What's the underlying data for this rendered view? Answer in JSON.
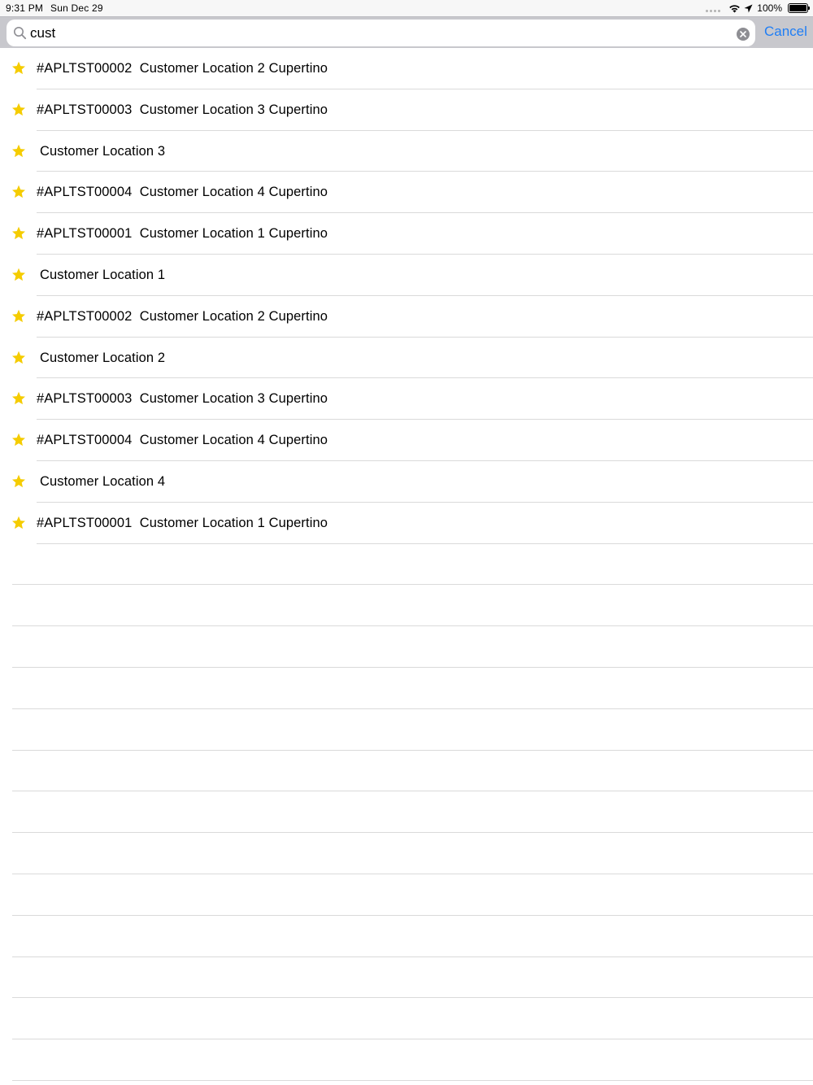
{
  "status_bar": {
    "time": "9:31 PM",
    "date": "Sun Dec 29",
    "battery_percent": "100%",
    "icons": [
      "cellular-dots-icon",
      "wifi-icon",
      "location-arrow-icon",
      "battery-icon"
    ]
  },
  "search": {
    "value": "cust",
    "placeholder": "",
    "cancel_label": "Cancel",
    "accent_color": "#1f7ef5"
  },
  "results": [
    {
      "text": "#APLTST00002  Customer Location 2 Cupertino",
      "starred": true
    },
    {
      "text": "#APLTST00003  Customer Location 3 Cupertino",
      "starred": true
    },
    {
      "text": "Customer Location 3",
      "starred": true
    },
    {
      "text": "#APLTST00004  Customer Location 4 Cupertino",
      "starred": true
    },
    {
      "text": "#APLTST00001  Customer Location 1 Cupertino",
      "starred": true
    },
    {
      "text": "Customer Location 1",
      "starred": true
    },
    {
      "text": "#APLTST00002  Customer Location 2 Cupertino",
      "starred": true
    },
    {
      "text": "Customer Location 2",
      "starred": true
    },
    {
      "text": "#APLTST00003  Customer Location 3 Cupertino",
      "starred": true
    },
    {
      "text": "#APLTST00004  Customer Location 4 Cupertino",
      "starred": true
    },
    {
      "text": "Customer Location 4",
      "starred": true
    },
    {
      "text": "#APLTST00001  Customer Location 1 Cupertino",
      "starred": true
    }
  ],
  "star_color": "#f5cc00"
}
